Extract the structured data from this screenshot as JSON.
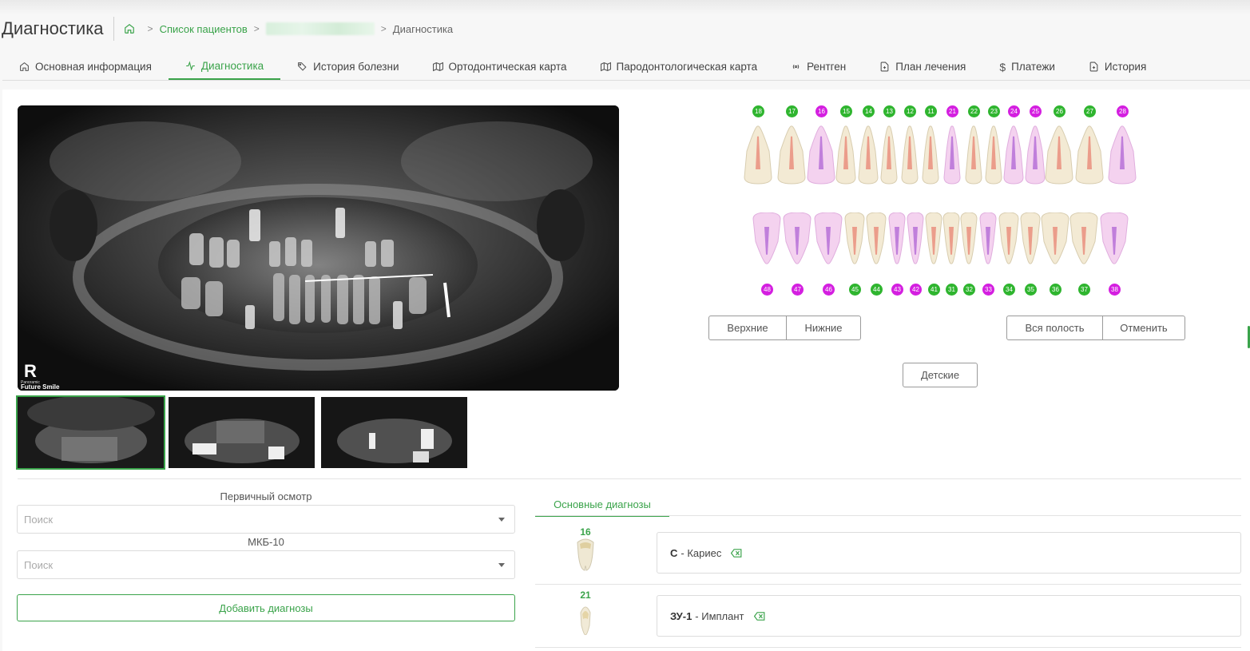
{
  "header": {
    "title": "Диагностика",
    "breadcrumb": {
      "patients": "Список пациентов",
      "current": "Диагностика"
    }
  },
  "tabs": [
    {
      "label": "Основная информация",
      "icon": "home-icon",
      "active": false
    },
    {
      "label": "Диагностика",
      "icon": "activity-icon",
      "active": true
    },
    {
      "label": "История болезни",
      "icon": "tag-icon",
      "active": false
    },
    {
      "label": "Ортодонтическая карта",
      "icon": "map-icon",
      "active": false
    },
    {
      "label": "Пародонтологическая карта",
      "icon": "map-icon",
      "active": false
    },
    {
      "label": "Рентген",
      "icon": "radio-icon",
      "active": false
    },
    {
      "label": "План лечения",
      "icon": "file-plus-icon",
      "active": false
    },
    {
      "label": "Платежи",
      "icon": "dollar-icon",
      "active": false
    },
    {
      "label": "История",
      "icon": "file-plus-icon",
      "active": false
    }
  ],
  "xray": {
    "watermark_letter": "R",
    "watermark_text": "Future Smile",
    "watermark_small": "Panoramic"
  },
  "teeth": {
    "upper": [
      {
        "n": "18",
        "c": "green"
      },
      {
        "n": "17",
        "c": "green"
      },
      {
        "n": "16",
        "c": "magenta"
      },
      {
        "n": "15",
        "c": "green"
      },
      {
        "n": "14",
        "c": "green"
      },
      {
        "n": "13",
        "c": "green"
      },
      {
        "n": "12",
        "c": "green"
      },
      {
        "n": "11",
        "c": "green"
      },
      {
        "n": "21",
        "c": "magenta"
      },
      {
        "n": "22",
        "c": "green"
      },
      {
        "n": "23",
        "c": "green"
      },
      {
        "n": "24",
        "c": "magenta"
      },
      {
        "n": "25",
        "c": "magenta"
      },
      {
        "n": "26",
        "c": "green"
      },
      {
        "n": "27",
        "c": "green"
      },
      {
        "n": "28",
        "c": "magenta"
      }
    ],
    "lower": [
      {
        "n": "48",
        "c": "magenta"
      },
      {
        "n": "47",
        "c": "magenta"
      },
      {
        "n": "46",
        "c": "magenta"
      },
      {
        "n": "45",
        "c": "green"
      },
      {
        "n": "44",
        "c": "green"
      },
      {
        "n": "43",
        "c": "magenta"
      },
      {
        "n": "42",
        "c": "magenta"
      },
      {
        "n": "41",
        "c": "green"
      },
      {
        "n": "31",
        "c": "green"
      },
      {
        "n": "32",
        "c": "green"
      },
      {
        "n": "33",
        "c": "magenta"
      },
      {
        "n": "34",
        "c": "green"
      },
      {
        "n": "35",
        "c": "green"
      },
      {
        "n": "36",
        "c": "green"
      },
      {
        "n": "37",
        "c": "green"
      },
      {
        "n": "38",
        "c": "magenta"
      }
    ],
    "colors": {
      "green": "#2fb52f",
      "magenta": "#d41fe0"
    }
  },
  "buttons": {
    "upper": "Верхние",
    "lower": "Нижние",
    "full": "Вся полость",
    "cancel": "Отменить",
    "kids": "Детские"
  },
  "form": {
    "exam_label": "Первичный осмотр",
    "exam_placeholder": "Поиск",
    "icd_label": "МКБ-10",
    "icd_placeholder": "Поиск",
    "add_button": "Добавить диагнозы"
  },
  "diagnoses": {
    "tab_label": "Основные диагнозы",
    "items": [
      {
        "tooth": "16",
        "code": "C",
        "name": "- Кариес"
      },
      {
        "tooth": "21",
        "code": "ЗУ-1",
        "name": "- Имплант"
      }
    ]
  },
  "accent_color": "#3aa34a"
}
